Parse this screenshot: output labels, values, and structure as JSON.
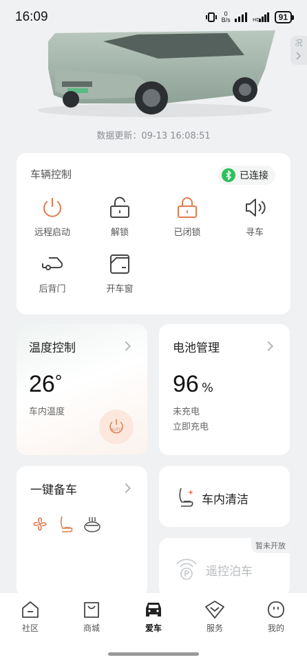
{
  "status_bar": {
    "time": "16:09",
    "net_speed_value": "0",
    "net_speed_unit": "B/s",
    "battery": "91"
  },
  "hero": {
    "side_tab_label": "况",
    "updated_text": "数据更新：09-13 16:08:51"
  },
  "vehicle_control": {
    "title": "车辆控制",
    "connection_status": "已连接",
    "controls": [
      {
        "label": "远程启动",
        "icon": "power-icon"
      },
      {
        "label": "解锁",
        "icon": "unlock-icon"
      },
      {
        "label": "已闭锁",
        "icon": "lock-icon"
      },
      {
        "label": "寻车",
        "icon": "speaker-icon"
      },
      {
        "label": "后背门",
        "icon": "car-tailgate-icon"
      },
      {
        "label": "开车窗",
        "icon": "car-window-icon"
      }
    ],
    "colors": {
      "accent": "#e07b4f",
      "icon_gray": "#444444",
      "connected": "#2ec05c"
    }
  },
  "temperature": {
    "title": "温度控制",
    "value": "26",
    "unit": "°",
    "label": "车内温度",
    "auto_label": "AUTO"
  },
  "battery_mgmt": {
    "title": "电池管理",
    "value": "96",
    "unit": "%",
    "status": "未充电",
    "action": "立即充电"
  },
  "one_key": {
    "title": "一键备车",
    "icons": [
      "fan-icon",
      "seat-heat-icon",
      "steering-heat-icon"
    ]
  },
  "cabin_clean": {
    "title": "车内清洁"
  },
  "remote_park": {
    "title": "遥控泊车",
    "badge": "暂未开放"
  },
  "bottom_nav": [
    {
      "label": "社区",
      "icon": "community-icon"
    },
    {
      "label": "商城",
      "icon": "shop-bag-icon"
    },
    {
      "label": "爱车",
      "icon": "car-front-icon",
      "active": true
    },
    {
      "label": "服务",
      "icon": "service-icon"
    },
    {
      "label": "我的",
      "icon": "profile-icon"
    }
  ]
}
